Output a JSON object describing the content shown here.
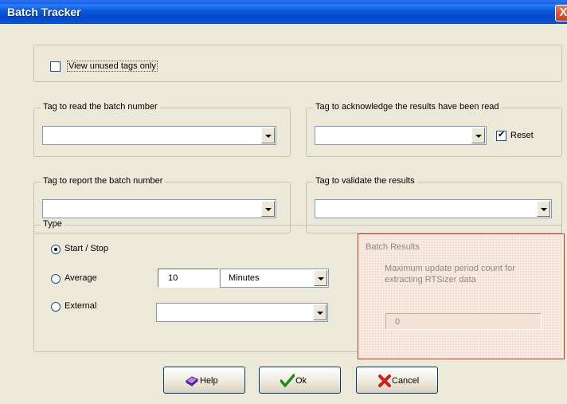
{
  "window": {
    "title": "Batch Tracker",
    "close_glyph": "X"
  },
  "view_unused": {
    "label": "View unused tags only",
    "checked": false
  },
  "read_batch": {
    "label": "Tag to read the batch number",
    "value": ""
  },
  "ack_results": {
    "label": "Tag to acknowledge the results have been read",
    "value": "",
    "reset_label": "Reset",
    "reset_checked": true
  },
  "report_batch": {
    "label": "Tag to report the batch number",
    "value": ""
  },
  "validate_results": {
    "label": "Tag to validate the results",
    "value": ""
  },
  "type": {
    "label": "Type",
    "options": [
      "Start / Stop",
      "Average",
      "External"
    ],
    "selected": "Start / Stop",
    "average_value": "10",
    "average_unit": "Minutes",
    "external_value": ""
  },
  "batch_results": {
    "label": "Batch Results",
    "description": "Maximum update period count for extracting RTSizer data",
    "value": "0"
  },
  "buttons": {
    "help": {
      "label": "Help",
      "icon": "help-book-icon"
    },
    "ok": {
      "label": "Ok",
      "icon": "checkmark-icon"
    },
    "cancel": {
      "label": "Cancel",
      "icon": "red-x-icon"
    }
  },
  "colors": {
    "titlebar": "#0a58dd",
    "dialog_bg": "#ece9d8",
    "highlight_border": "#c0392b"
  }
}
